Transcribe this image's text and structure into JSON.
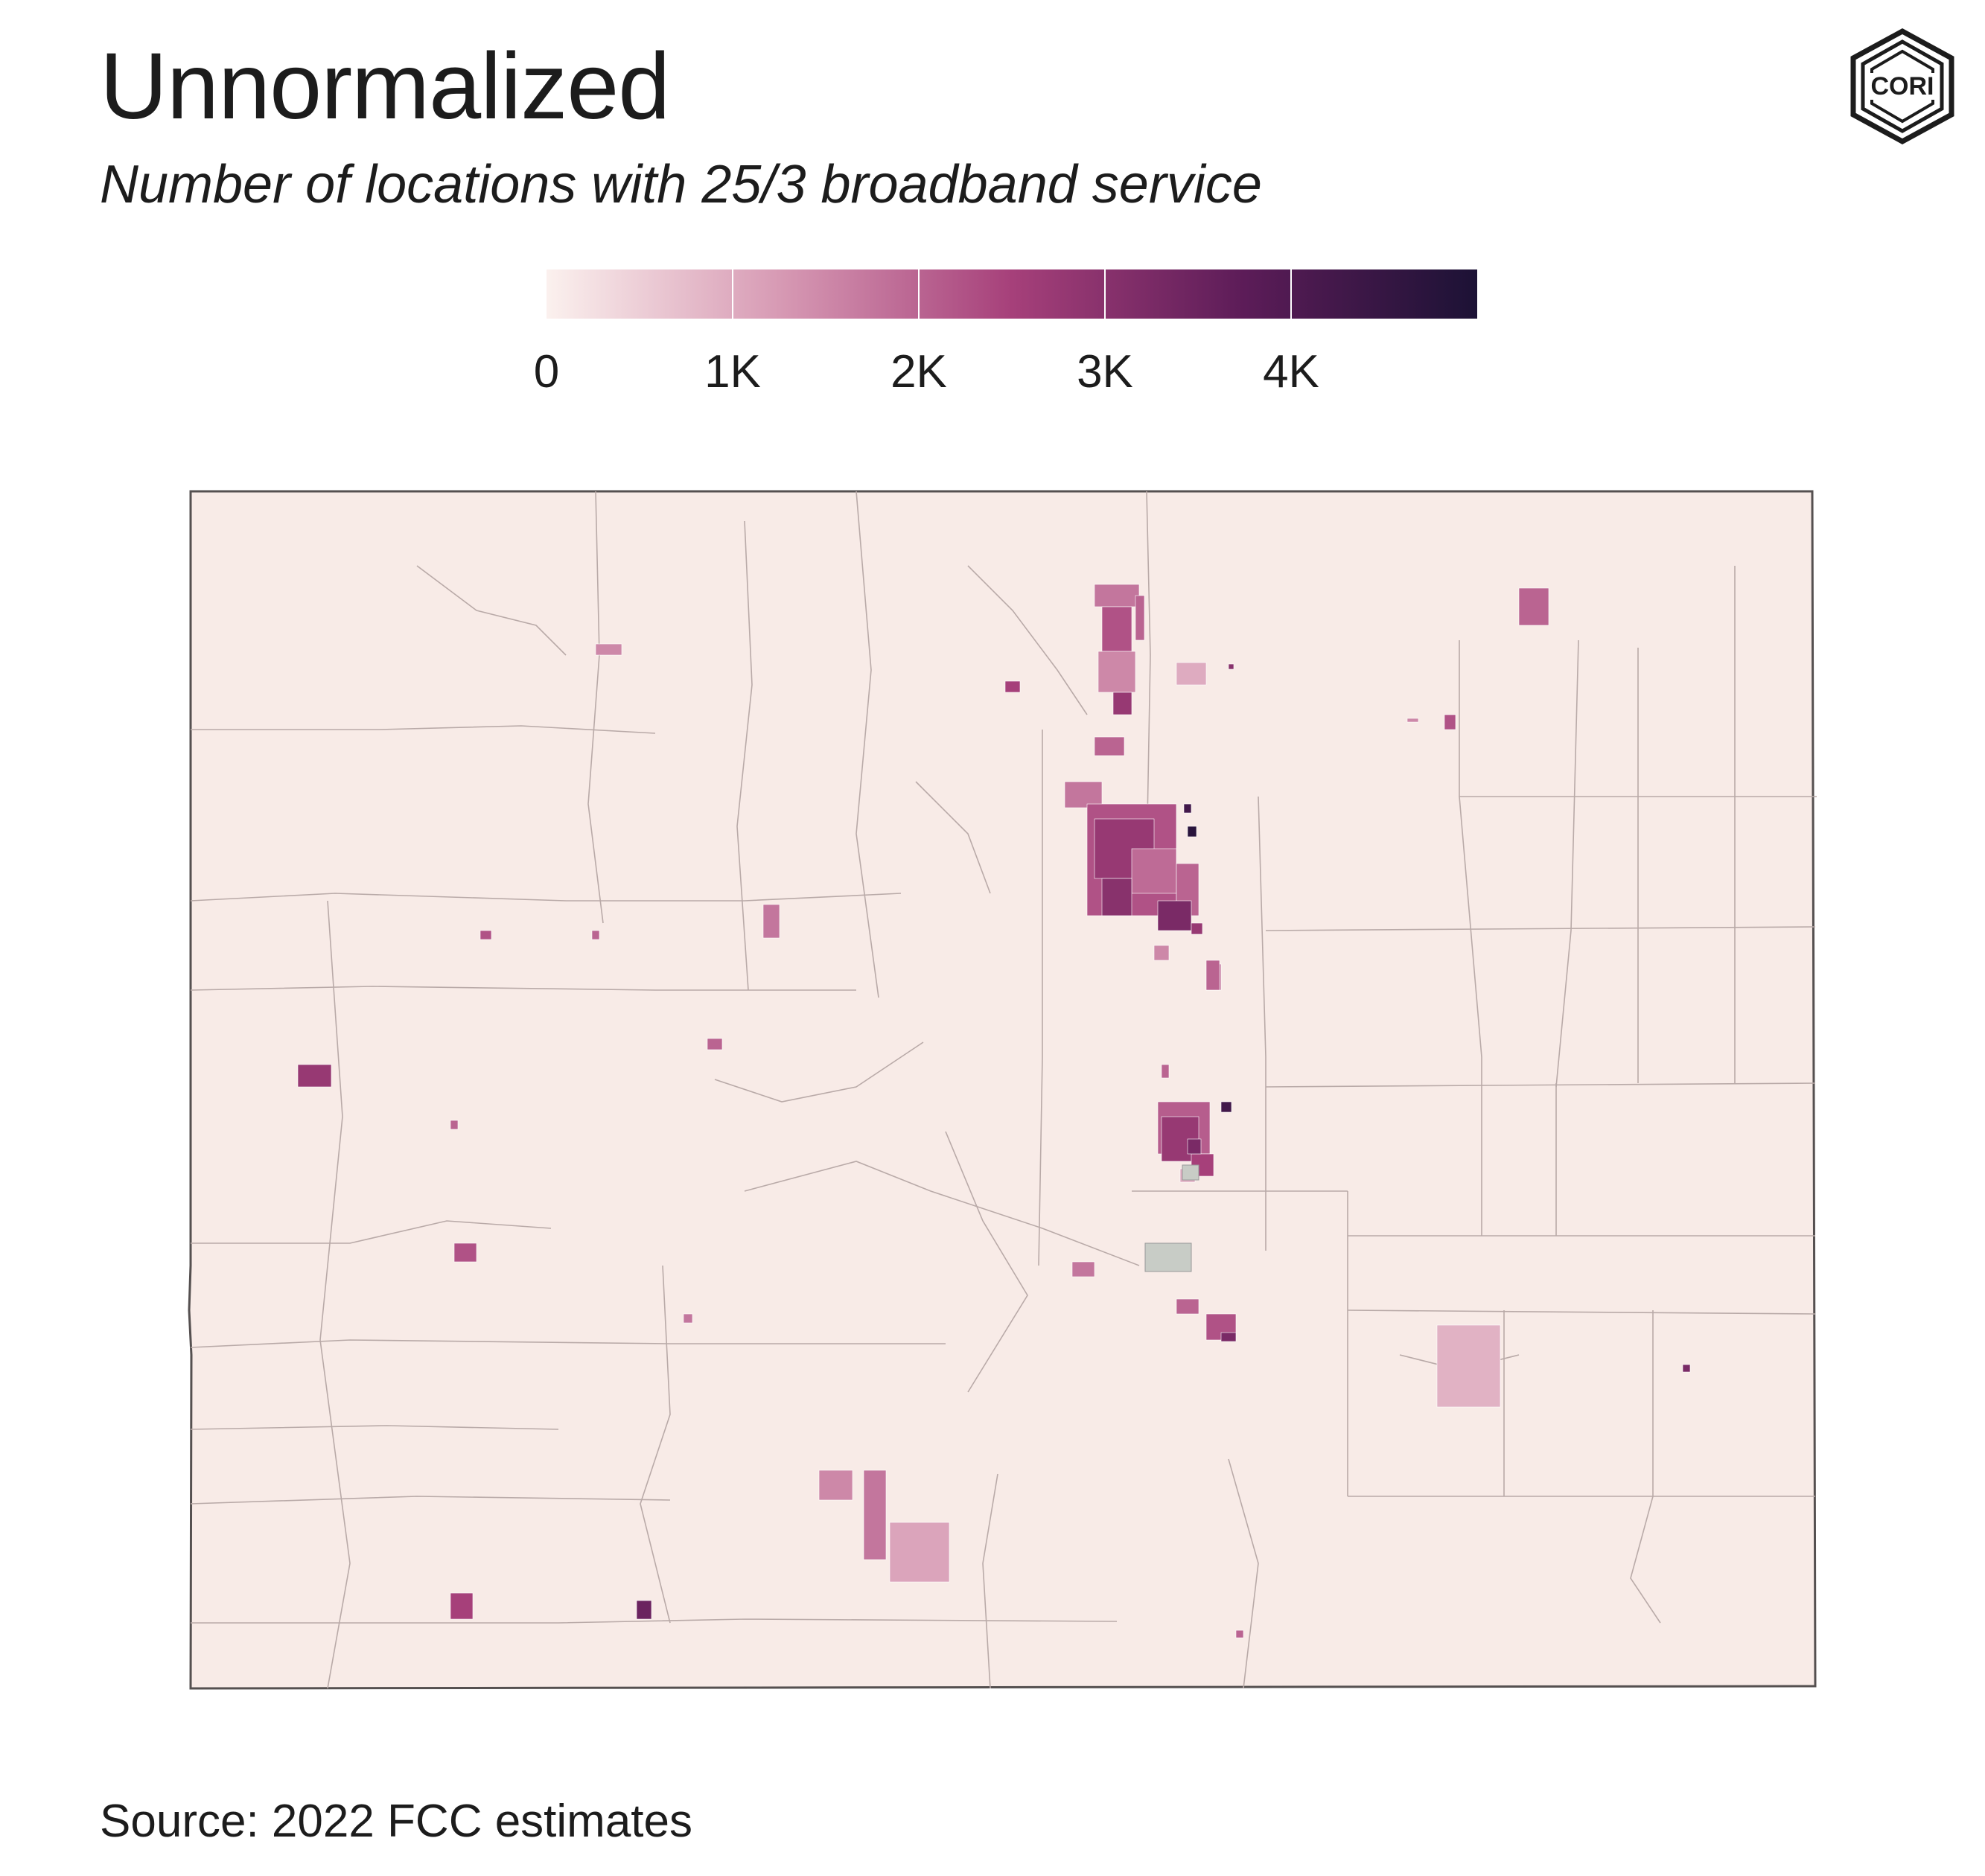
{
  "header": {
    "title": "Unnormalized",
    "subtitle": "Number of locations with 25/3 broadband service"
  },
  "logo": {
    "text": "CORI",
    "icon": "cori-hexagon-logo"
  },
  "legend": {
    "type": "continuous-colorbar",
    "min": 0,
    "max": 5000,
    "ticks": [
      {
        "value": 0,
        "label": "0"
      },
      {
        "value": 1000,
        "label": "1K"
      },
      {
        "value": 2000,
        "label": "2K"
      },
      {
        "value": 3000,
        "label": "3K"
      },
      {
        "value": 4000,
        "label": "4K"
      }
    ],
    "color_stops": [
      "#fbf1ee",
      "#d79ab4",
      "#a6407a",
      "#5c1c58",
      "#1c1235"
    ]
  },
  "map": {
    "region": "Colorado",
    "base_color": "#f8ebe7",
    "boundary_color": "#b9aaa8",
    "no_data_color": "#c8ccc6"
  },
  "source": "Source: 2022 FCC estimates"
}
